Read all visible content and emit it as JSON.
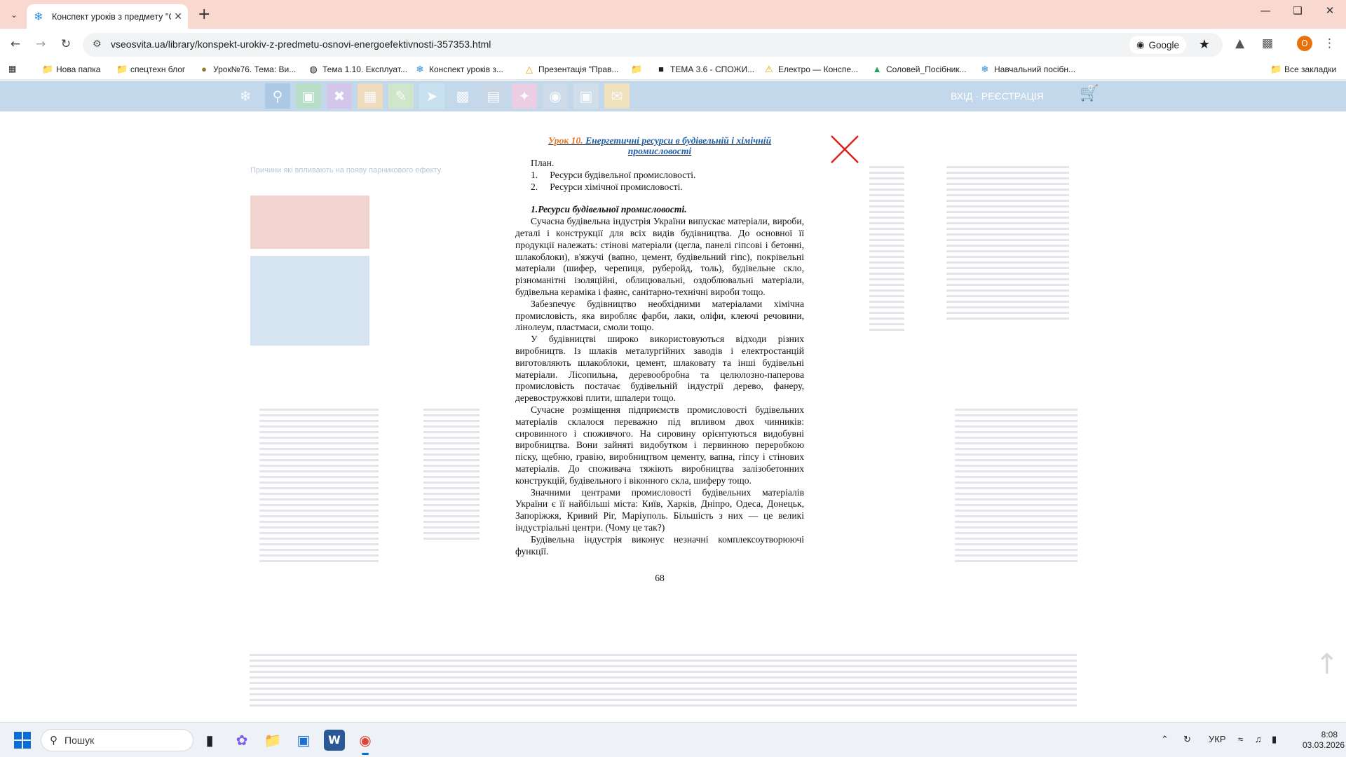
{
  "browser": {
    "tab": {
      "title": "Конспект уроків з предмету \"С",
      "favicon": "snowflake-icon"
    },
    "url": "vseosvita.ua/library/konspekt-urokiv-z-predmetu-osnovi-energoefektivnosti-357353.html",
    "search_chip": "Google",
    "profile_initial": "O",
    "bookmarks": [
      {
        "label": "Нова папка",
        "icon": "folder-icon"
      },
      {
        "label": "спецтехн блог",
        "icon": "folder-icon"
      },
      {
        "label": "Урок№76. Тема: Ви...",
        "icon": "site-icon"
      },
      {
        "label": "Тема 1.10. Експлуат...",
        "icon": "site-icon"
      },
      {
        "label": "Конспект уроків з...",
        "icon": "snowflake-icon"
      },
      {
        "label": "Презентація \"Прав...",
        "icon": "site-icon"
      },
      {
        "label": "",
        "icon": "folder-icon"
      },
      {
        "label": "ТЕМА 3.6 - СПОЖИ...",
        "icon": "site-icon"
      },
      {
        "label": "Електро — Конспе...",
        "icon": "warning-icon"
      },
      {
        "label": "Соловей_Посібник...",
        "icon": "drive-icon"
      },
      {
        "label": "Навчальний посібн...",
        "icon": "snowflake-icon"
      }
    ],
    "all_bookmarks": "Все закладки"
  },
  "site": {
    "login_label": "ВХІД · РЕЄСТРАЦІЯ",
    "cart_count": "0"
  },
  "document": {
    "lesson_number": "Урок 10.",
    "lesson_title": "Енергетичні ресурси в будівельній і хімічній промисловості",
    "plan_label": "План.",
    "plan_items": [
      "1.     Ресурси будівельної промисловості.",
      "2.     Ресурси хімічної промисловості."
    ],
    "section_heading": "1.Ресурси будівельної промисловості.",
    "paragraphs": [
      "Сучасна будівельна індустрія України випускає матеріали, вироби, деталі і конструкції для всіх видів будівництва. До основної її продукції належать: стінові матеріали (цегла, панелі гіпсові і бетонні, шлакоблоки), в'яжучі (вапно, цемент, будівельний гіпс), покрівельні матеріали (шифер, черепиця, руберойд, толь), будівельне скло, різноманітні ізоляційні, облицювальні, оздоблювальні матеріали, будівельна кераміка і фаянс, санітарно-технічні вироби тощо.",
      "Забезпечує будівництво необхідними матеріалами хімічна промисловість, яка виробляє фарби, лаки, оліфи, клеючі речовини, лінолеум, пластмаси, смоли тощо.",
      "У будівництві широко використовуються відходи різних виробництв. Із шлаків металургійних заводів і електростанцій виготовляють шлакоблоки, цемент, шлаковату та інші будівельні матеріали. Лісопильна, деревообробна та целюлозно-паперова промисловість постачає будівельній індустрії дерево, фанеру, деревостружкові плити, шпалери тощо.",
      "Сучасне розміщення підприємств промисловості будівельних матеріалів склалося переважно під впливом двох чинників: сировинного і споживчого. На сировину орієнтуються видобувні виробництва. Вони зайняті видобутком і первинною переробкою піску, щебню, гравію, виробництвом цементу, вапна, гіпсу і стінових матеріалів. До споживача тяжіють виробництва залізобетонних конструкцій, будівельного і віконного скла, шиферу тощо.",
      "Значними центрами промисловості будівельних матеріалів України є її найбільші міста: Київ, Харків, Дніпро, Одеса, Донецьк, Запоріжжя, Кривий Ріг, Маріуполь. Більшість з них — це великі індустріальні центри. (Чому це так?)",
      "Будівельна індустрія виконує незначні комплексоутворюючі функції."
    ],
    "page_number": "68"
  },
  "ghost": {
    "title": "Причини які впливають на появу парникового ефекту"
  },
  "taskbar": {
    "search_placeholder": "Пошук",
    "language": "УКР",
    "time": "8:08",
    "date": "03.03.2026"
  }
}
